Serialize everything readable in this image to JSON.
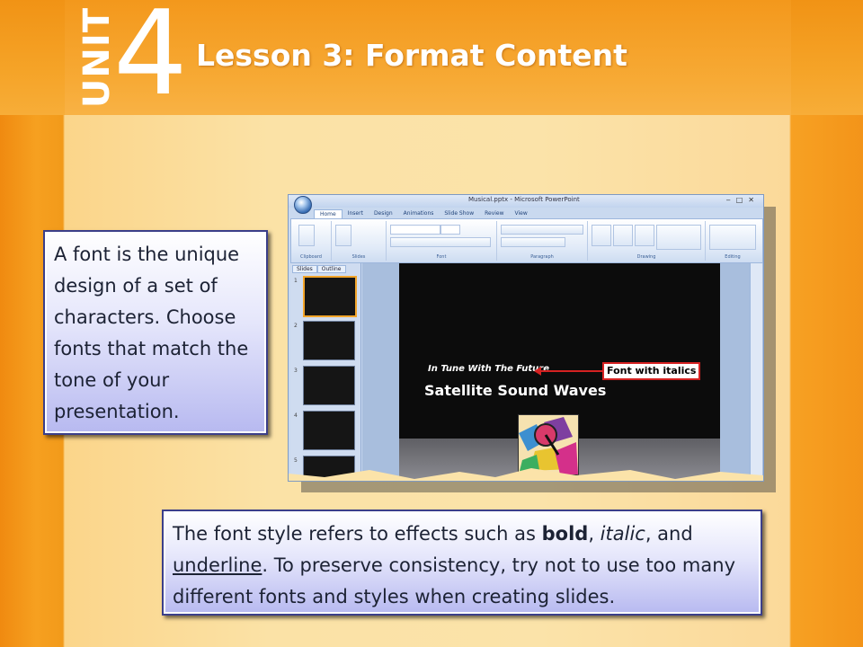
{
  "header": {
    "unit_word": "UNIT",
    "unit_number": "4",
    "lesson_title": "Lesson 3: Format Content"
  },
  "callout_left": {
    "text": "A font is the unique design of a set of characters. Choose fonts that match the tone of your presentation."
  },
  "callout_bottom": {
    "before_bold": "The font style refers to effects such as ",
    "bold_word": "bold",
    "comma1": ", ",
    "italic_word": "italic",
    "and_text": ", and ",
    "underline_word": "underline",
    "after": ". To preserve consistency, try not to use too many different fonts and styles when creating slides."
  },
  "screenshot": {
    "window_title": "Musical.pptx - Microsoft PowerPoint",
    "ribbon_tabs": [
      "Home",
      "Insert",
      "Design",
      "Animations",
      "Slide Show",
      "Review",
      "View"
    ],
    "ribbon_groups": [
      "Clipboard",
      "Slides",
      "Font",
      "Paragraph",
      "Drawing",
      "Editing"
    ],
    "pane_tabs": [
      "Slides",
      "Outline"
    ],
    "slide_subtitle": "In Tune With The Future",
    "slide_title": "Satellite Sound Waves",
    "annotation": "Font with italics",
    "thumb_numbers": [
      "1",
      "2",
      "3",
      "4",
      "5"
    ],
    "colors": {
      "annotation_red": "#d52222",
      "slide_bg": "#0c0c0c",
      "ribbon_blue": "#dfe9f7"
    }
  }
}
